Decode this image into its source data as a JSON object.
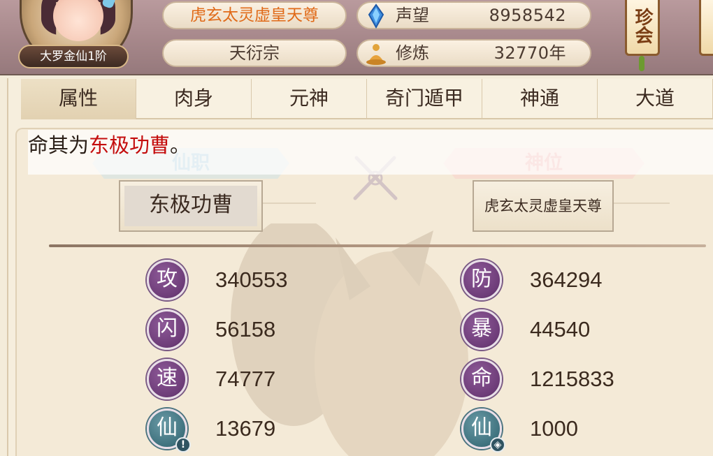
{
  "header": {
    "rank_label": "大罗金仙1阶",
    "title": "虎玄太灵虚皇天尊",
    "sect": "天衍宗",
    "fame": {
      "label": "声望",
      "value": "8958542",
      "icon": "crystal-icon"
    },
    "cultivation": {
      "label": "修炼",
      "value": "32770年",
      "icon": "meditation-icon"
    },
    "side_button": "珍会"
  },
  "tabs": [
    "属性",
    "肉身",
    "元神",
    "奇门遁甲",
    "神通",
    "大道"
  ],
  "notice": {
    "prefix": "命其为",
    "highlight": "东极功曹",
    "suffix": "。"
  },
  "position": {
    "xianzhi_label": "仙职",
    "xianzhi_value": "东极功曹",
    "shenwei_label": "神位",
    "shenwei_value": "虎玄太灵虚皇天尊"
  },
  "stats": [
    {
      "glyph": "攻",
      "value": "340553",
      "color": "purple"
    },
    {
      "glyph": "防",
      "value": "364294",
      "color": "purple"
    },
    {
      "glyph": "闪",
      "value": "56158",
      "color": "purple"
    },
    {
      "glyph": "暴",
      "value": "44540",
      "color": "purple"
    },
    {
      "glyph": "速",
      "value": "74777",
      "color": "purple"
    },
    {
      "glyph": "命",
      "value": "1215833",
      "color": "purple"
    },
    {
      "glyph": "仙",
      "value": "13679",
      "color": "teal",
      "sub_icon": "exclamation-icon"
    },
    {
      "glyph": "仙",
      "value": "1000",
      "color": "teal",
      "sub_icon": "shield-icon"
    }
  ],
  "colors": {
    "title_orange": "#e06a18",
    "highlight_red": "#c40d0d",
    "badge_purple": "#6d3c78",
    "badge_teal": "#3f727e"
  }
}
